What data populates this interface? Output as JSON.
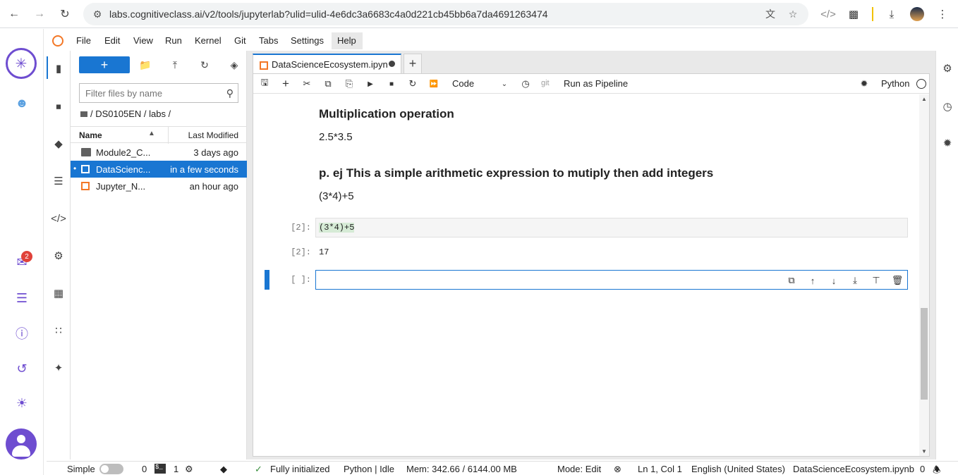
{
  "browser": {
    "url": "labs.cognitiveclass.ai/v2/tools/jupyterlab?ulid=ulid-4e6dc3a6683c4a0d221cb45bb6a7da4691263474"
  },
  "rail": {
    "notification_count": "2"
  },
  "menu": {
    "items": [
      "File",
      "Edit",
      "View",
      "Run",
      "Kernel",
      "Git",
      "Tabs",
      "Settings",
      "Help"
    ]
  },
  "filebrowser": {
    "new_label": "+",
    "filter_placeholder": "Filter files by name",
    "breadcrumb": "/ DS0105EN / labs /",
    "col_name": "Name",
    "col_modified": "Last Modified",
    "rows": [
      {
        "name": "Module2_C...",
        "modified": "3 days ago"
      },
      {
        "name": "DataScienc...",
        "modified": "in a few seconds"
      },
      {
        "name": "Jupyter_N...",
        "modified": "an hour ago"
      }
    ]
  },
  "notebook": {
    "tab_label": "DataScienceEcosystem.ipyn",
    "cell_type": "Code",
    "git_label": "git",
    "pipeline_label": "Run as Pipeline",
    "kernel_name": "Python",
    "md1_heading": "Multiplication operation",
    "md1_text": "2.5*3.5",
    "md2_heading": "p. ej This a simple arithmetic expression to mutiply then add integers",
    "md2_text": "(3*4)+5",
    "code_prompt": "[2]:",
    "code_text": "(3*4)+5",
    "output_prompt": "[2]:",
    "output_text": "17",
    "empty_prompt": "[ ]:"
  },
  "status": {
    "mode_label": "Simple",
    "terminals_count": "0",
    "kernels_count": "1",
    "init_status": "Fully initialized",
    "kernel_status": "Python | Idle",
    "memory": "Mem: 342.66 / 6144.00 MB",
    "edit_mode": "Mode: Edit",
    "cursor": "Ln 1, Col 1",
    "language": "English (United States)",
    "filename": "DataScienceEcosystem.ipynb",
    "notif_count": "0"
  }
}
